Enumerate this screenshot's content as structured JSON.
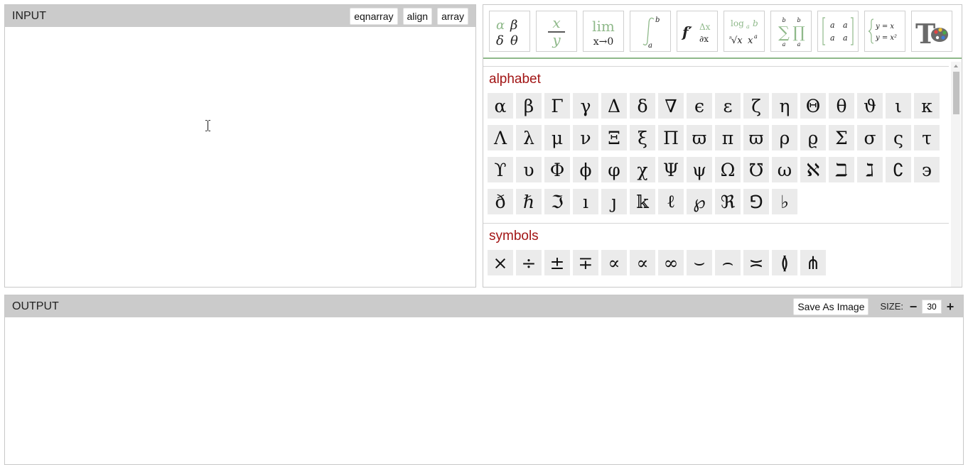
{
  "input": {
    "title": "INPUT",
    "buttons": [
      "eqnarray",
      "align",
      "array"
    ]
  },
  "palette": {
    "toolbar": [
      {
        "name": "greek-letters-tool"
      },
      {
        "name": "fraction-tool"
      },
      {
        "name": "limit-tool"
      },
      {
        "name": "integral-tool"
      },
      {
        "name": "derivative-tool"
      },
      {
        "name": "log-root-tool"
      },
      {
        "name": "sum-product-tool"
      },
      {
        "name": "matrix-tool"
      },
      {
        "name": "cases-tool"
      },
      {
        "name": "text-color-tool"
      }
    ],
    "tool_text": {
      "greek_a": "α",
      "greek_b": "β",
      "greek_c": "δ",
      "greek_d": "θ",
      "frac_num": "x",
      "frac_den": "y",
      "lim": "lim",
      "lim_sub": "x→0",
      "int_upper": "b",
      "int_lower": "a",
      "deriv_f": "f′",
      "deriv_top": "Δx",
      "deriv_bot": "∂x",
      "log": "log",
      "log_sub": "a",
      "log_arg": "b",
      "root_text": "√x",
      "root_idx": "n",
      "pow_base": "x",
      "pow_exp": "a",
      "sum_top": "b",
      "sum_bot": "a",
      "prod_top": "b",
      "prod_bot": "a",
      "matrix_cells": [
        "a",
        "a",
        "a",
        "a"
      ],
      "cases_row1": "y = x",
      "cases_row2": "y = x²",
      "tex_t": "T"
    },
    "sections": [
      {
        "title": "alphabet",
        "symbols": [
          "α",
          "β",
          "Γ",
          "γ",
          "Δ",
          "δ",
          "∇",
          "ϵ",
          "ε",
          "ζ",
          "η",
          "Θ",
          "θ",
          "ϑ",
          "ι",
          "κ",
          "Λ",
          "λ",
          "μ",
          "ν",
          "Ξ",
          "ξ",
          "Π",
          "ϖ",
          "π",
          "ϖ",
          "ρ",
          "ϱ",
          "Σ",
          "σ",
          "ς",
          "τ",
          "ϒ",
          "υ",
          "Φ",
          "ϕ",
          "φ",
          "χ",
          "Ψ",
          "ψ",
          "Ω",
          "℧",
          "ω",
          "ℵ",
          "ℶ",
          "ℷ",
          "∁",
          "϶",
          "ð",
          "ℏ",
          "ℑ",
          "ı",
          "ȷ",
          "𝕜",
          "ℓ",
          "℘",
          "ℜ",
          "⅁",
          "♭"
        ]
      },
      {
        "title": "symbols",
        "symbols": [
          "×",
          "÷",
          "±",
          "∓",
          "∝",
          "∝",
          "∞",
          "⌣",
          "⌢",
          "≍",
          "≬",
          "⋔"
        ]
      }
    ]
  },
  "output": {
    "title": "OUTPUT",
    "save_label": "Save As Image",
    "size_label": "SIZE:",
    "size_minus": "−",
    "size_value": "30",
    "size_plus": "+"
  },
  "colors": {
    "header_bg": "#cbcbcb",
    "section_title": "#a21515",
    "toolbar_green": "#8fb98a",
    "symbol_bg": "#ebebeb"
  }
}
